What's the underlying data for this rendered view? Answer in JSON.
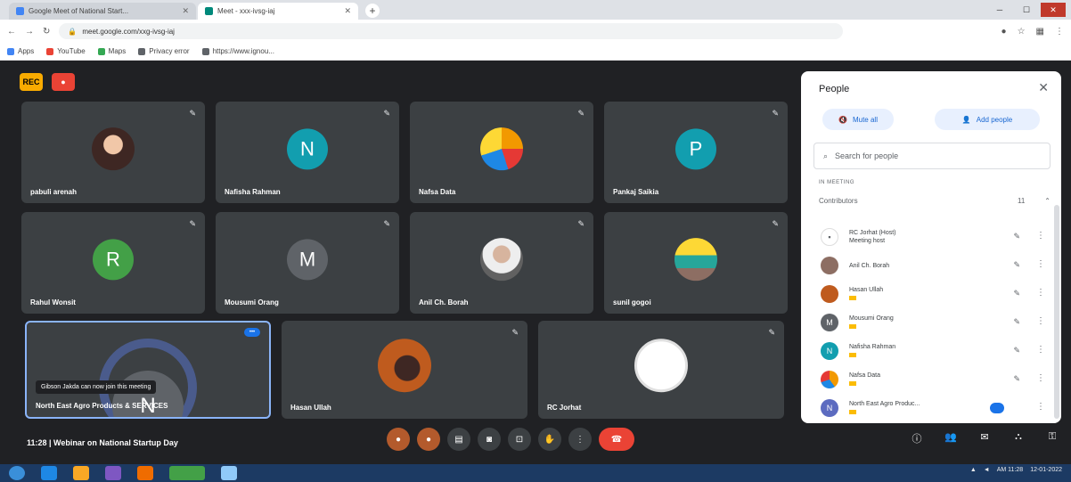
{
  "browser": {
    "tabs": [
      {
        "label": "Google Meet of National Start...",
        "active": false,
        "fav_color": "#4285f4"
      },
      {
        "label": "Meet - xxx-ivsg-iaj",
        "active": true,
        "fav_color": "#00897b"
      }
    ],
    "new_tab_glyph": "+",
    "url": "meet.google.com/xxg-ivsg-iaj",
    "bookmarks": [
      {
        "label": "Apps",
        "color": "#4285f4"
      },
      {
        "label": "YouTube",
        "color": "#ea4335"
      },
      {
        "label": "Maps",
        "color": "#34a853"
      },
      {
        "label": "Privacy error",
        "color": "#5f6368"
      },
      {
        "label": "https://www.ignou...",
        "color": "#5f6368"
      }
    ]
  },
  "meet": {
    "top_badges": [
      {
        "label": "REC",
        "color": "#f9ab00"
      },
      {
        "label": "●",
        "color": "#ea4335"
      }
    ],
    "tiles": [
      {
        "name": "pabuli arenah",
        "type": "photo",
        "color": "#6d4c41",
        "muted": true
      },
      {
        "name": "Nafisha Rahman",
        "type": "letter",
        "letter": "N",
        "color": "#129eaf",
        "muted": true
      },
      {
        "name": "Nafsa Data",
        "type": "photo",
        "color": "#f29900",
        "muted": true
      },
      {
        "name": "Pankaj Saikia",
        "type": "letter",
        "letter": "P",
        "color": "#129eaf",
        "muted": true
      },
      {
        "name": "Rahul Wonsit",
        "type": "letter",
        "letter": "R",
        "color": "#43a047",
        "muted": true
      },
      {
        "name": "Mousumi Orang",
        "type": "letter",
        "letter": "M",
        "color": "#5f6368",
        "muted": true
      },
      {
        "name": "Anil Ch. Borah",
        "type": "photo",
        "color": "#9e9e9e",
        "muted": true
      },
      {
        "name": "sunil gogoi",
        "type": "photo",
        "color": "#c0ca33",
        "muted": true
      },
      {
        "name": "North East Agro Products & SERVICES",
        "type": "letter",
        "letter": "N",
        "color": "#5f6368",
        "muted": false,
        "highlight": true,
        "tooltip": "Gibson Jakda can now join this meeting"
      },
      {
        "name": "Hasan Ullah",
        "type": "photo",
        "color": "#bf5b1e",
        "muted": true
      },
      {
        "name": "RC Jorhat",
        "type": "photo",
        "color": "#ffffff",
        "muted": true
      }
    ],
    "meeting_label": "11:28  |  Webinar on National Startup Day",
    "controls": [
      "reaction-1",
      "reaction-2",
      "captions",
      "present",
      "screen",
      "raise-hand",
      "more",
      "end-call"
    ]
  },
  "people_panel": {
    "title": "People",
    "close_glyph": "✕",
    "mute_all_label": "Mute all",
    "add_people_label": "Add people",
    "search_placeholder": "Search for people",
    "section_label": "IN MEETING",
    "contributors_label": "Contributors",
    "contributors_count": "11",
    "participants": [
      {
        "name": "RC Jorhat (Host)\nMeeting host",
        "color": "#ffffff",
        "letter": "R",
        "tag": false
      },
      {
        "name": "Anil Ch. Borah",
        "color": "#8d6e63",
        "letter": "",
        "tag": false
      },
      {
        "name": "Hasan Ullah",
        "color": "#bf5b1e",
        "letter": "",
        "tag": true
      },
      {
        "name": "Mousumi Orang",
        "color": "#5f6368",
        "letter": "M",
        "tag": true
      },
      {
        "name": "Nafisha Rahman",
        "color": "#129eaf",
        "letter": "N",
        "tag": true
      },
      {
        "name": "Nafsa Data",
        "color": "#f29900",
        "letter": "",
        "tag": true
      },
      {
        "name": "North East Agro Produc...",
        "color": "#5c6bc0",
        "letter": "N",
        "tag": true
      }
    ]
  },
  "taskbar": {
    "time": "AM 11:28",
    "date": "12-01-2022"
  }
}
